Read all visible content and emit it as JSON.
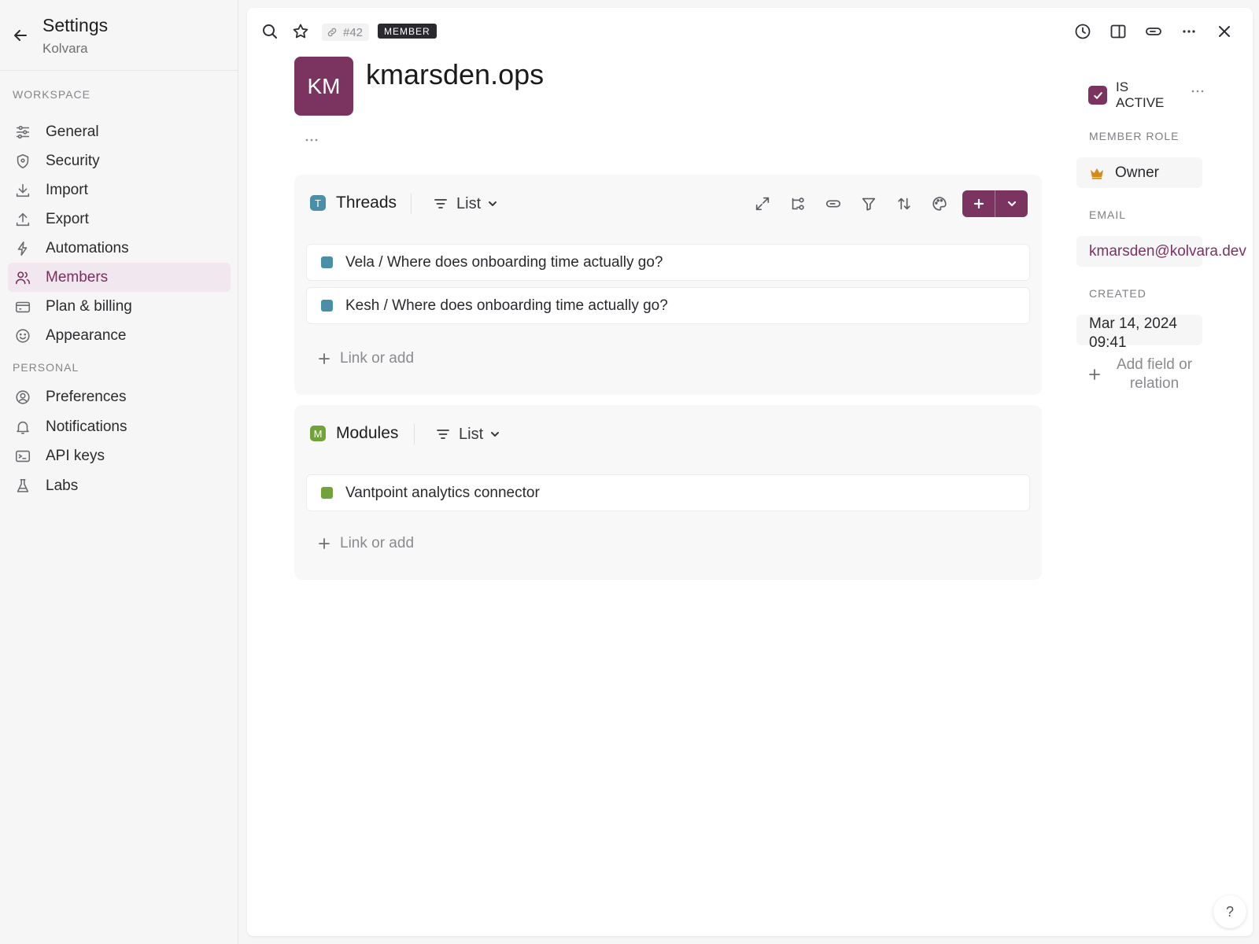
{
  "sidebar": {
    "title": "Settings",
    "subtitle": "Kolvara",
    "sections": [
      {
        "label": "WORKSPACE",
        "items": [
          {
            "label": "General",
            "icon": "sliders-icon"
          },
          {
            "label": "Security",
            "icon": "shield-icon"
          },
          {
            "label": "Import",
            "icon": "download-icon"
          },
          {
            "label": "Export",
            "icon": "upload-icon"
          },
          {
            "label": "Automations",
            "icon": "bolt-icon"
          },
          {
            "label": "Members",
            "icon": "users-icon",
            "active": true
          },
          {
            "label": "Plan & billing",
            "icon": "credit-card-icon"
          },
          {
            "label": "Appearance",
            "icon": "smiley-icon"
          }
        ]
      },
      {
        "label": "PERSONAL",
        "items": [
          {
            "label": "Preferences",
            "icon": "user-circle-icon"
          },
          {
            "label": "Notifications",
            "icon": "bell-icon"
          },
          {
            "label": "API keys",
            "icon": "terminal-icon"
          },
          {
            "label": "Labs",
            "icon": "flask-icon"
          }
        ]
      }
    ]
  },
  "record": {
    "id_tag": "#42",
    "type_tag": "MEMBER",
    "avatar_initials": "KM",
    "name": "kmarsden.ops"
  },
  "groups": [
    {
      "badge": "T",
      "badge_color": "#4a8fa8",
      "title": "Threads",
      "view": "List",
      "rows": [
        "Vela / Where does onboarding time actually go?",
        "Kesh / Where does onboarding time actually go?"
      ],
      "row_color": "#4a8fa8",
      "link_add": "Link or add"
    },
    {
      "badge": "M",
      "badge_color": "#72a23a",
      "title": "Modules",
      "view": "List",
      "rows": [
        "Vantpoint analytics connector"
      ],
      "row_color": "#72a23a",
      "link_add": "Link or add"
    }
  ],
  "properties": {
    "is_active_label": "IS ACTIVE",
    "is_active": true,
    "member_role_label": "MEMBER ROLE",
    "member_role": "Owner",
    "email_label": "EMAIL",
    "email": "kmarsden@kolvara.dev",
    "created_label": "CREATED",
    "created": "Mar 14, 2024 09:41",
    "add_field": "Add field or relation"
  },
  "help": "?",
  "colors": {
    "accent": "#7b3360",
    "active_nav_bg": "#f1e7ee"
  }
}
